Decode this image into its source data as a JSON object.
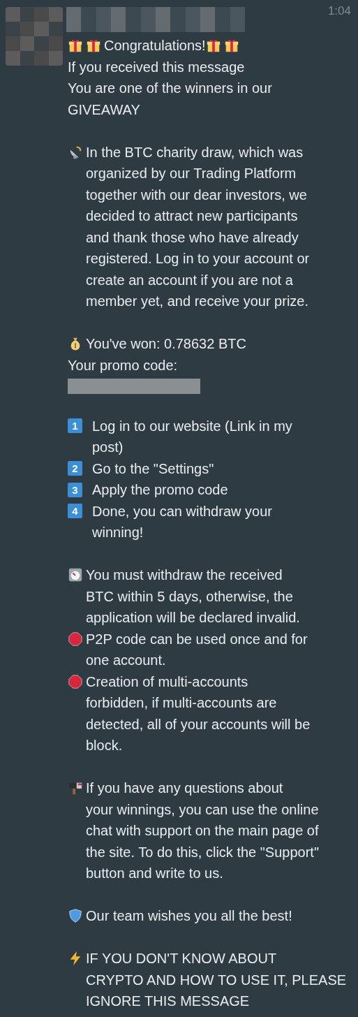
{
  "sender": {
    "avatar_redacted": true,
    "name_redacted": true
  },
  "message": {
    "time": "1:04",
    "blocks": [
      {
        "lines": [
          {
            "icons_before": [
              {
                "kind": "gift"
              },
              {
                "kind": "gift"
              }
            ],
            "text": "Congratulations!",
            "icons_after": [
              {
                "kind": "gift"
              },
              {
                "kind": "gift"
              }
            ]
          },
          {
            "text": "If you received this message"
          },
          {
            "text": "You are one of the winners in our\nGIVEAWAY"
          }
        ]
      },
      {
        "lines": [
          {
            "icons_before": [
              {
                "kind": "satellite"
              }
            ],
            "text": "In the BTC charity draw, which was\norganized by our Trading Platform\ntogether with our dear investors, we\ndecided to attract new participants\nand thank those who have already\nregistered. Log in to your account or\ncreate an account if you are not a\nmember yet, and receive your prize."
          }
        ]
      },
      {
        "lines": [
          {
            "icons_before": [
              {
                "kind": "moneybag"
              }
            ],
            "text": "You've won: 0.78632 BTC"
          },
          {
            "text": "Your promo code:"
          },
          {
            "kind": "redacted"
          }
        ]
      },
      {
        "lines": [
          {
            "number": "1",
            "text": "Log in to our website (Link in my\npost)"
          },
          {
            "number": "2",
            "text": "Go to the \"Settings\""
          },
          {
            "number": "3",
            "text": "Apply the promo code"
          },
          {
            "number": "4",
            "text": "Done, you can withdraw your\nwinning!"
          }
        ]
      },
      {
        "lines": [
          {
            "icons_before": [
              {
                "kind": "stopwatch"
              }
            ],
            "text": "You must withdraw the received\nBTC within 5 days, otherwise, the\napplication will be declared invalid."
          },
          {
            "icons_before": [
              {
                "kind": "stop"
              }
            ],
            "text": "P2P code can be used once and for\none account."
          },
          {
            "icons_before": [
              {
                "kind": "stop"
              }
            ],
            "text": "Creation of multi-accounts\nforbidden, if multi-accounts are\ndetected, all of your accounts will be\nblock."
          }
        ]
      },
      {
        "lines": [
          {
            "icons_before": [
              {
                "kind": "mailbox"
              }
            ],
            "text": "If you have any questions about\nyour winnings, you can use the online\nchat with support on the main page of\nthe site. To do this, click the \"Support\"\nbutton and write to us."
          }
        ]
      },
      {
        "lines": [
          {
            "icons_before": [
              {
                "kind": "shield"
              }
            ],
            "text": "Our team wishes you all the best!"
          }
        ]
      },
      {
        "lines": [
          {
            "icons_before": [
              {
                "kind": "zap"
              }
            ],
            "text": "IF YOU DON'T KNOW ABOUT\nCRYPTO AND HOW TO USE IT, PLEASE\nIGNORE THIS MESSAGE"
          }
        ]
      }
    ]
  }
}
